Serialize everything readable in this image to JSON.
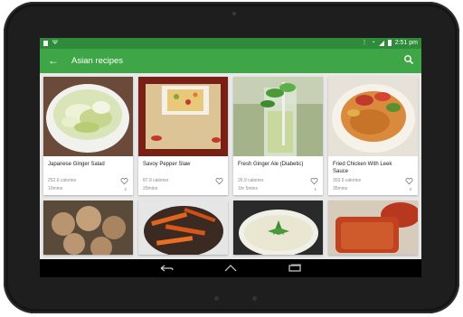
{
  "status_bar": {
    "time": "2:51 pm"
  },
  "toolbar": {
    "title": "Asian recipes"
  },
  "recipes": [
    {
      "name": "Japanese Ginger Salad",
      "calories": "252.6 calories",
      "time": "10mins",
      "likes": "2"
    },
    {
      "name": "Savoy Pepper Slaw",
      "calories": "87.9 calories",
      "time": "20mins",
      "likes": ""
    },
    {
      "name": "Fresh Ginger Ale (Diabetic)",
      "calories": "26.9 calories",
      "time": "1hr 5mins",
      "likes": "1"
    },
    {
      "name": "Fried Chicken With Leek Sauce",
      "calories": "303.5 calories",
      "time": "35mins",
      "likes": "3"
    }
  ],
  "icons": {
    "back": "arrow-left-icon",
    "search": "search-icon",
    "heart": "heart-outline-icon"
  },
  "colors": {
    "status_bar": "#2e8b3a",
    "toolbar": "#3fa648",
    "background": "#e8e8e8",
    "nav_bar": "#000000"
  }
}
